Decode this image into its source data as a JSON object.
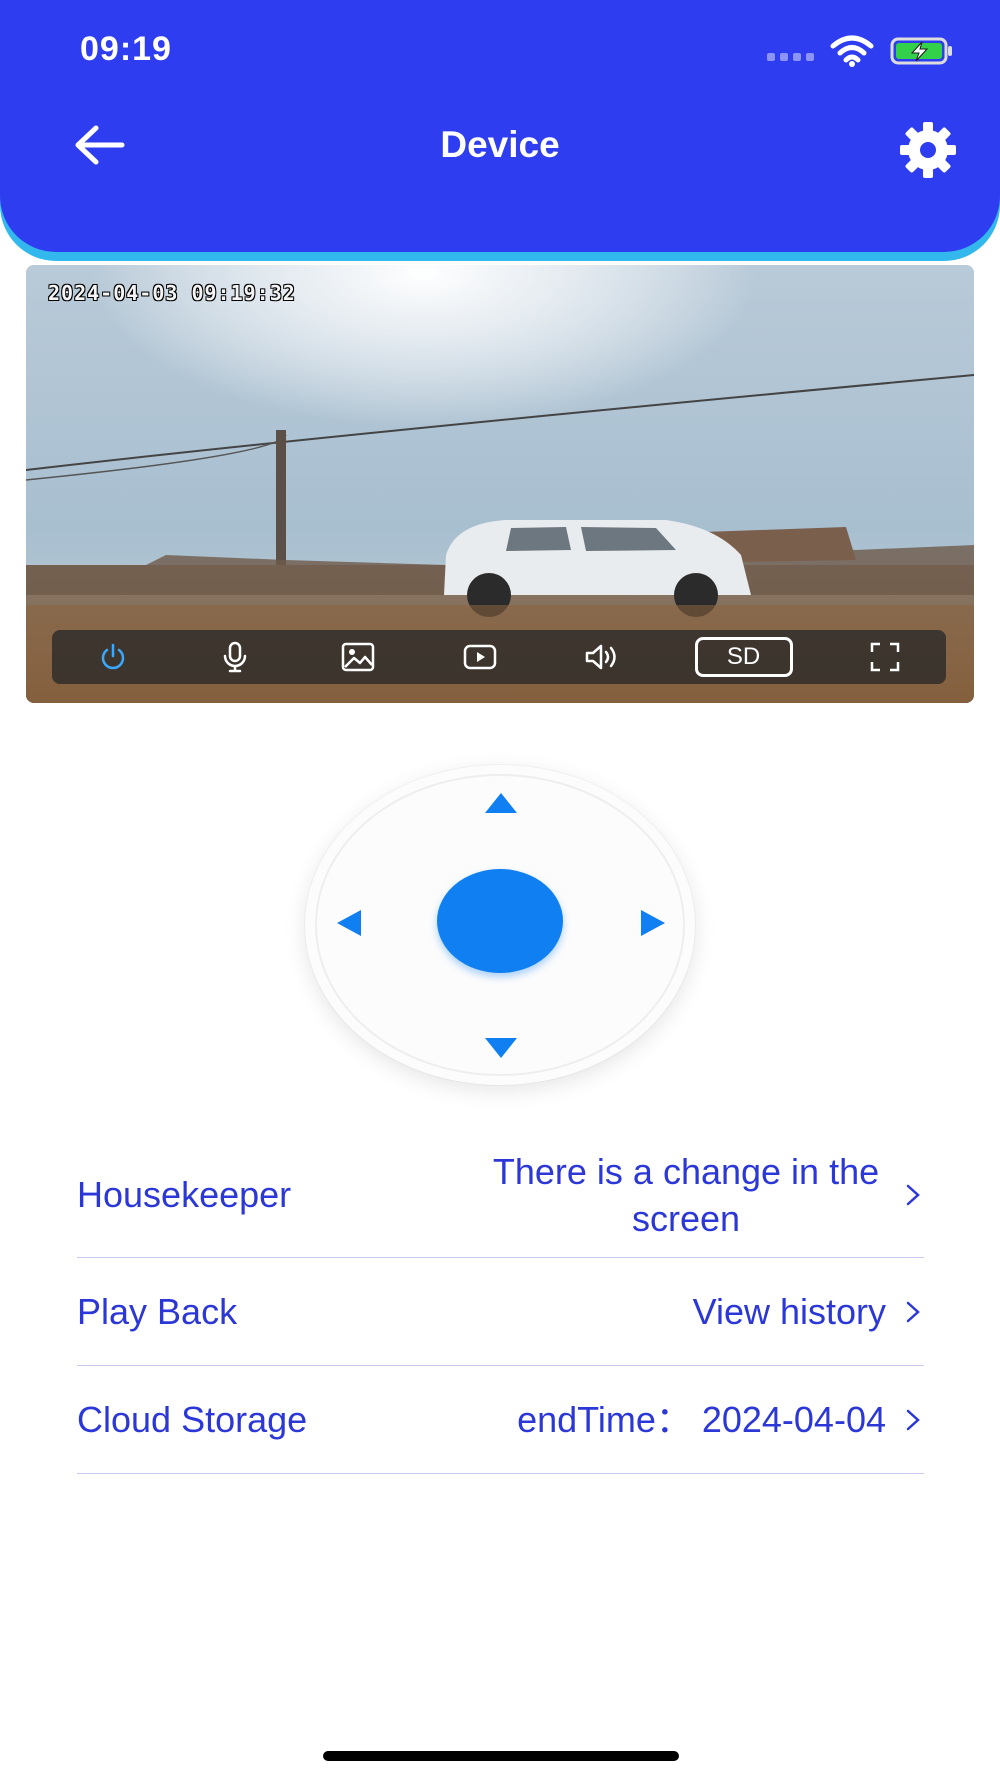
{
  "status_bar": {
    "time": "09:19",
    "icons": [
      "signal-icon",
      "wifi-icon",
      "battery-charging-icon"
    ],
    "battery_color": "#33d14a"
  },
  "header": {
    "title": "Device",
    "back_icon": "back-arrow-icon",
    "settings_icon": "gear-icon",
    "background": "#2f3df0",
    "accent": "#33b8ee"
  },
  "video": {
    "timestamp": "2024-04-03 09:19:32",
    "toolbar": {
      "buttons": [
        "power-icon",
        "microphone-icon",
        "snapshot-icon",
        "record-icon",
        "speaker-icon",
        "sd-quality",
        "fullscreen-icon"
      ],
      "sd_label": "SD",
      "power_color": "#3aa8ff"
    }
  },
  "ptz": {
    "controls": [
      "up-arrow-icon",
      "down-arrow-icon",
      "left-arrow-icon",
      "right-arrow-icon",
      "center-button"
    ],
    "color": "#0f7ff2"
  },
  "menu": {
    "items": [
      {
        "label": "Housekeeper",
        "value": "There is a change in the screen"
      },
      {
        "label": "Play Back",
        "value": "View history"
      },
      {
        "label": "Cloud Storage",
        "value": "endTime： 2024-04-04"
      }
    ],
    "text_color": "#2c37d8"
  }
}
